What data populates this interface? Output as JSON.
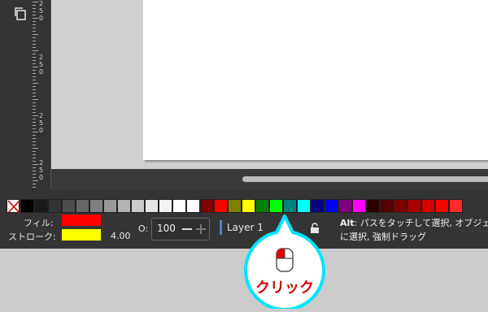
{
  "ruler": {
    "groups": [
      [
        "2",
        "5",
        "0"
      ],
      [
        "2",
        "5",
        "0"
      ],
      [
        "2",
        "5",
        "0"
      ],
      [
        "2",
        "5",
        "0"
      ]
    ]
  },
  "palette": {
    "colors": [
      "#000000",
      "#1a1a1a",
      "#333333",
      "#4d4d4d",
      "#666666",
      "#808080",
      "#999999",
      "#b3b3b3",
      "#cccccc",
      "#e6e6e6",
      "#f2f2f2",
      "#ffffff",
      "#ffffff",
      "#800000",
      "#ff0000",
      "#808000",
      "#ffff00",
      "#008000",
      "#00ff00",
      "#008080",
      "#00ffff",
      "#000080",
      "#0000ff",
      "#800080",
      "#ff00ff",
      "#2b0000",
      "#550000",
      "#800000",
      "#aa0000",
      "#d40000",
      "#ff0000",
      "#ff2a2a"
    ]
  },
  "statusbar": {
    "fill_label": "フィル:",
    "stroke_label": "ストローク:",
    "fill_color": "#ff0000",
    "stroke_color": "#ffff00",
    "stroke_width": "4.00",
    "opacity_label": "O:",
    "opacity_value": "100",
    "layer_name": "Layer 1",
    "hint_key": "Alt",
    "hint_line1": ": パスをタッチして選択, オブジェクトを",
    "hint_line2": "に選択, 強制ドラッグ"
  },
  "callout": {
    "label": "クリック",
    "accent_color": "#00e6ff",
    "icon": "mouse-left-click-icon"
  }
}
